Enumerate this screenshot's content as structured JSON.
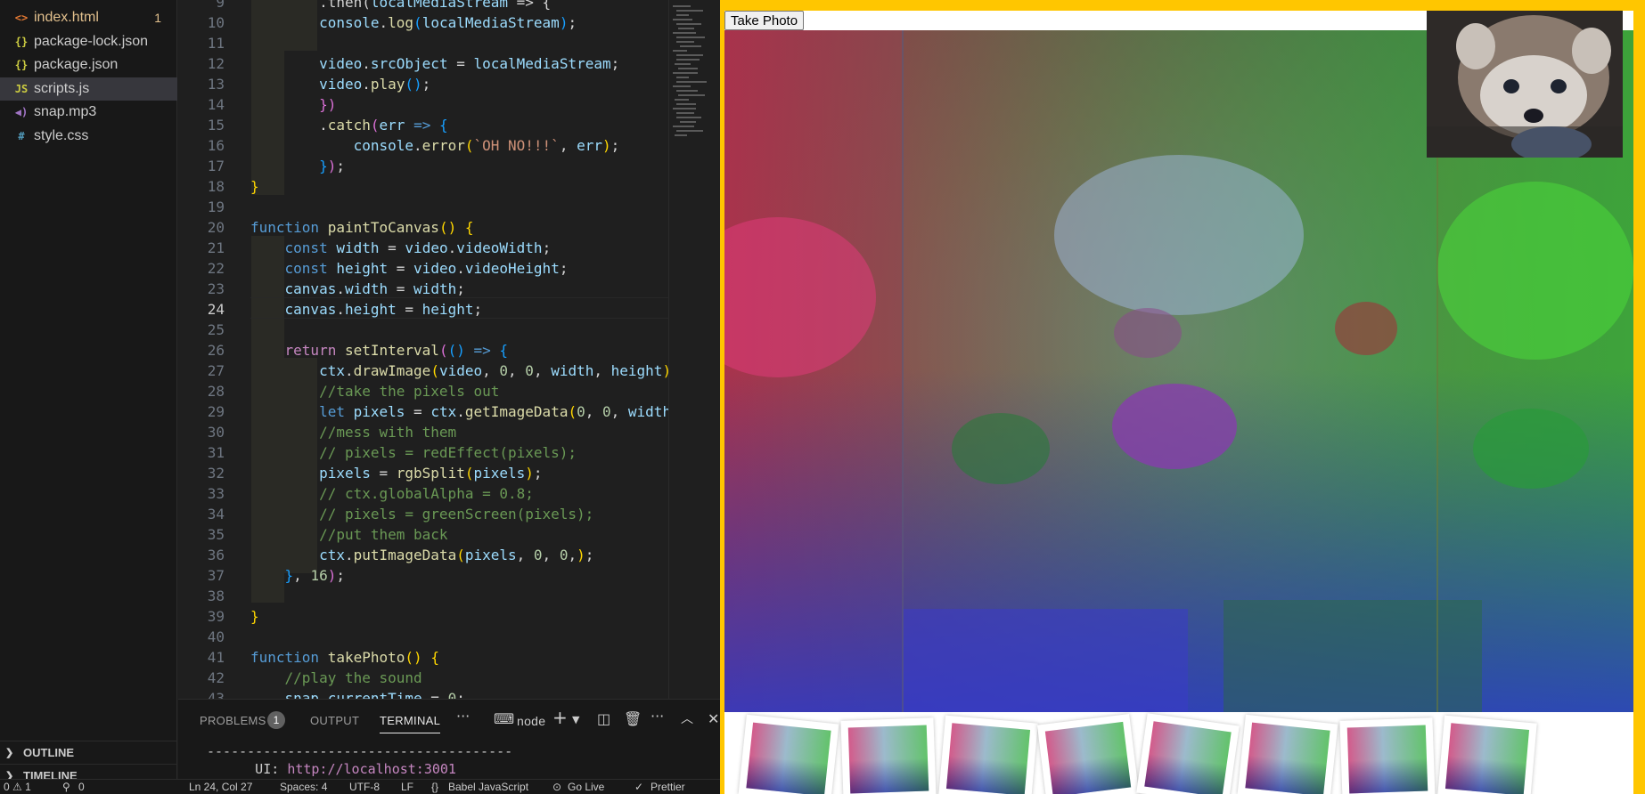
{
  "sidebar": {
    "files": [
      {
        "name": "index.html",
        "icon": "<>",
        "icon_color": "#e37933",
        "badge": "1",
        "modified": true
      },
      {
        "name": "package-lock.json",
        "icon": "{}",
        "icon_color": "#cbcb41"
      },
      {
        "name": "package.json",
        "icon": "{}",
        "icon_color": "#cbcb41"
      },
      {
        "name": "scripts.js",
        "icon": "JS",
        "icon_color": "#cbcb41",
        "active": true
      },
      {
        "name": "snap.mp3",
        "icon": "◀)",
        "icon_color": "#a074c4"
      },
      {
        "name": "style.css",
        "icon": "#",
        "icon_color": "#519aba"
      }
    ],
    "sections": [
      "OUTLINE",
      "TIMELINE"
    ]
  },
  "editor": {
    "current_line": 24,
    "lines": [
      {
        "n": "9",
        "tokens": [
          [
            "plain",
            "        "
          ],
          [
            "plain",
            ".then("
          ],
          [
            "var",
            "localMediaStream"
          ],
          [
            "plain",
            " => {"
          ]
        ]
      },
      {
        "n": "10",
        "tokens": [
          [
            "plain",
            "        "
          ],
          [
            "var",
            "console"
          ],
          [
            "plain",
            "."
          ],
          [
            "fn",
            "log"
          ],
          [
            "p3",
            "("
          ],
          [
            "var",
            "localMediaStream"
          ],
          [
            "p3",
            ")"
          ],
          [
            "plain",
            ";"
          ]
        ]
      },
      {
        "n": "11",
        "tokens": []
      },
      {
        "n": "12",
        "tokens": [
          [
            "plain",
            "        "
          ],
          [
            "var",
            "video"
          ],
          [
            "plain",
            "."
          ],
          [
            "var",
            "srcObject"
          ],
          [
            "plain",
            " = "
          ],
          [
            "var",
            "localMediaStream"
          ],
          [
            "plain",
            ";"
          ]
        ]
      },
      {
        "n": "13",
        "tokens": [
          [
            "plain",
            "        "
          ],
          [
            "var",
            "video"
          ],
          [
            "plain",
            "."
          ],
          [
            "fn",
            "play"
          ],
          [
            "p3",
            "()"
          ],
          [
            "plain",
            ";"
          ]
        ]
      },
      {
        "n": "14",
        "tokens": [
          [
            "plain",
            "        "
          ],
          [
            "p2",
            "})"
          ]
        ]
      },
      {
        "n": "15",
        "tokens": [
          [
            "plain",
            "        "
          ],
          [
            "plain",
            "."
          ],
          [
            "fn",
            "catch"
          ],
          [
            "p2",
            "("
          ],
          [
            "var",
            "err"
          ],
          [
            "plain",
            " "
          ],
          [
            "kw",
            "=>"
          ],
          [
            "plain",
            " "
          ],
          [
            "p3",
            "{"
          ]
        ]
      },
      {
        "n": "16",
        "tokens": [
          [
            "plain",
            "            "
          ],
          [
            "var",
            "console"
          ],
          [
            "plain",
            "."
          ],
          [
            "fn",
            "error"
          ],
          [
            "p1",
            "("
          ],
          [
            "str",
            "`OH NO!!!`"
          ],
          [
            "plain",
            ", "
          ],
          [
            "var",
            "err"
          ],
          [
            "p1",
            ")"
          ],
          [
            "plain",
            ";"
          ]
        ]
      },
      {
        "n": "17",
        "tokens": [
          [
            "plain",
            "        "
          ],
          [
            "p3",
            "}"
          ],
          [
            "p2",
            ")"
          ],
          [
            "plain",
            ";"
          ]
        ]
      },
      {
        "n": "18",
        "tokens": [
          [
            "p1",
            "}"
          ]
        ]
      },
      {
        "n": "19",
        "tokens": []
      },
      {
        "n": "20",
        "tokens": [
          [
            "kw",
            "function"
          ],
          [
            "plain",
            " "
          ],
          [
            "fn",
            "paintToCanvas"
          ],
          [
            "p1",
            "()"
          ],
          [
            "plain",
            " "
          ],
          [
            "p1",
            "{"
          ]
        ]
      },
      {
        "n": "21",
        "tokens": [
          [
            "plain",
            "    "
          ],
          [
            "kw",
            "const"
          ],
          [
            "plain",
            " "
          ],
          [
            "var",
            "width"
          ],
          [
            "plain",
            " = "
          ],
          [
            "var",
            "video"
          ],
          [
            "plain",
            "."
          ],
          [
            "var",
            "videoWidth"
          ],
          [
            "plain",
            ";"
          ]
        ]
      },
      {
        "n": "22",
        "tokens": [
          [
            "plain",
            "    "
          ],
          [
            "kw",
            "const"
          ],
          [
            "plain",
            " "
          ],
          [
            "var",
            "height"
          ],
          [
            "plain",
            " = "
          ],
          [
            "var",
            "video"
          ],
          [
            "plain",
            "."
          ],
          [
            "var",
            "videoHeight"
          ],
          [
            "plain",
            ";"
          ]
        ]
      },
      {
        "n": "23",
        "tokens": [
          [
            "plain",
            "    "
          ],
          [
            "var",
            "canvas"
          ],
          [
            "plain",
            "."
          ],
          [
            "var",
            "width"
          ],
          [
            "plain",
            " = "
          ],
          [
            "var",
            "width"
          ],
          [
            "plain",
            ";"
          ]
        ]
      },
      {
        "n": "24",
        "tokens": [
          [
            "plain",
            "    "
          ],
          [
            "var",
            "canvas"
          ],
          [
            "plain",
            "."
          ],
          [
            "var",
            "height"
          ],
          [
            "plain",
            " = "
          ],
          [
            "var",
            "height"
          ],
          [
            "plain",
            ";"
          ]
        ]
      },
      {
        "n": "25",
        "tokens": []
      },
      {
        "n": "26",
        "tokens": [
          [
            "plain",
            "    "
          ],
          [
            "kw2",
            "return"
          ],
          [
            "plain",
            " "
          ],
          [
            "fn",
            "setInterval"
          ],
          [
            "p2",
            "("
          ],
          [
            "p3",
            "()"
          ],
          [
            "plain",
            " "
          ],
          [
            "kw",
            "=>"
          ],
          [
            "plain",
            " "
          ],
          [
            "p3",
            "{"
          ]
        ]
      },
      {
        "n": "27",
        "tokens": [
          [
            "plain",
            "        "
          ],
          [
            "var",
            "ctx"
          ],
          [
            "plain",
            "."
          ],
          [
            "fn",
            "drawImage"
          ],
          [
            "p1",
            "("
          ],
          [
            "var",
            "video"
          ],
          [
            "plain",
            ", "
          ],
          [
            "num",
            "0"
          ],
          [
            "plain",
            ", "
          ],
          [
            "num",
            "0"
          ],
          [
            "plain",
            ", "
          ],
          [
            "var",
            "width"
          ],
          [
            "plain",
            ", "
          ],
          [
            "var",
            "height"
          ],
          [
            "p1",
            ")"
          ],
          [
            "plain",
            ";"
          ]
        ]
      },
      {
        "n": "28",
        "tokens": [
          [
            "plain",
            "        "
          ],
          [
            "cm",
            "//take the pixels out"
          ]
        ]
      },
      {
        "n": "29",
        "tokens": [
          [
            "plain",
            "        "
          ],
          [
            "kw",
            "let"
          ],
          [
            "plain",
            " "
          ],
          [
            "var",
            "pixels"
          ],
          [
            "plain",
            " = "
          ],
          [
            "var",
            "ctx"
          ],
          [
            "plain",
            "."
          ],
          [
            "fn",
            "getImageData"
          ],
          [
            "p1",
            "("
          ],
          [
            "num",
            "0"
          ],
          [
            "plain",
            ", "
          ],
          [
            "num",
            "0"
          ],
          [
            "plain",
            ", "
          ],
          [
            "var",
            "width"
          ],
          [
            "plain",
            ","
          ]
        ]
      },
      {
        "n": "30",
        "tokens": [
          [
            "plain",
            "        "
          ],
          [
            "cm",
            "//mess with them"
          ]
        ]
      },
      {
        "n": "31",
        "tokens": [
          [
            "plain",
            "        "
          ],
          [
            "cm",
            "// pixels = redEffect(pixels);"
          ]
        ]
      },
      {
        "n": "32",
        "tokens": [
          [
            "plain",
            "        "
          ],
          [
            "var",
            "pixels"
          ],
          [
            "plain",
            " = "
          ],
          [
            "fn",
            "rgbSplit"
          ],
          [
            "p1",
            "("
          ],
          [
            "var",
            "pixels"
          ],
          [
            "p1",
            ")"
          ],
          [
            "plain",
            ";"
          ]
        ]
      },
      {
        "n": "33",
        "tokens": [
          [
            "plain",
            "        "
          ],
          [
            "cm",
            "// ctx.globalAlpha = 0.8;"
          ]
        ]
      },
      {
        "n": "34",
        "tokens": [
          [
            "plain",
            "        "
          ],
          [
            "cm",
            "// pixels = greenScreen(pixels);"
          ]
        ]
      },
      {
        "n": "35",
        "tokens": [
          [
            "plain",
            "        "
          ],
          [
            "cm",
            "//put them back"
          ]
        ]
      },
      {
        "n": "36",
        "tokens": [
          [
            "plain",
            "        "
          ],
          [
            "var",
            "ctx"
          ],
          [
            "plain",
            "."
          ],
          [
            "fn",
            "putImageData"
          ],
          [
            "p1",
            "("
          ],
          [
            "var",
            "pixels"
          ],
          [
            "plain",
            ", "
          ],
          [
            "num",
            "0"
          ],
          [
            "plain",
            ", "
          ],
          [
            "num",
            "0"
          ],
          [
            "plain",
            ","
          ],
          [
            "p1",
            ")"
          ],
          [
            "plain",
            ";"
          ]
        ]
      },
      {
        "n": "37",
        "tokens": [
          [
            "plain",
            "    "
          ],
          [
            "p3",
            "}"
          ],
          [
            "plain",
            ", "
          ],
          [
            "num",
            "16"
          ],
          [
            "p2",
            ")"
          ],
          [
            "plain",
            ";"
          ]
        ]
      },
      {
        "n": "38",
        "tokens": []
      },
      {
        "n": "39",
        "tokens": [
          [
            "p1",
            "}"
          ]
        ]
      },
      {
        "n": "40",
        "tokens": []
      },
      {
        "n": "41",
        "tokens": [
          [
            "kw",
            "function"
          ],
          [
            "plain",
            " "
          ],
          [
            "fn",
            "takePhoto"
          ],
          [
            "p1",
            "()"
          ],
          [
            "plain",
            " "
          ],
          [
            "p1",
            "{"
          ]
        ]
      },
      {
        "n": "42",
        "tokens": [
          [
            "plain",
            "    "
          ],
          [
            "cm",
            "//play the sound"
          ]
        ]
      },
      {
        "n": "43",
        "tokens": [
          [
            "plain",
            "    "
          ],
          [
            "var",
            "snap"
          ],
          [
            "plain",
            "."
          ],
          [
            "var",
            "currentTime"
          ],
          [
            "plain",
            " = "
          ],
          [
            "num",
            "0"
          ],
          [
            "plain",
            ";"
          ]
        ]
      }
    ]
  },
  "panel": {
    "tabs": [
      "PROBLEMS",
      "OUTPUT",
      "TERMINAL"
    ],
    "active_tab": "TERMINAL",
    "problems_count": "1",
    "more": "···",
    "terminal_name": "node",
    "terminal_lines": [
      {
        "text": "--------------------------------------",
        "link": ""
      },
      {
        "text": "      UI: ",
        "link": "http://localhost:3001"
      }
    ]
  },
  "status": {
    "problems": "0 ⚠ 1",
    "ports": "0",
    "position": "Ln 24, Col 27",
    "spaces": "Spaces: 4",
    "encoding": "UTF-8",
    "eol": "LF",
    "language": "Babel JavaScript",
    "golive": "Go Live",
    "prettier": "Prettier"
  },
  "page": {
    "take_photo_label": "Take Photo",
    "background": "#ffc600",
    "snapshot_count": 8
  }
}
